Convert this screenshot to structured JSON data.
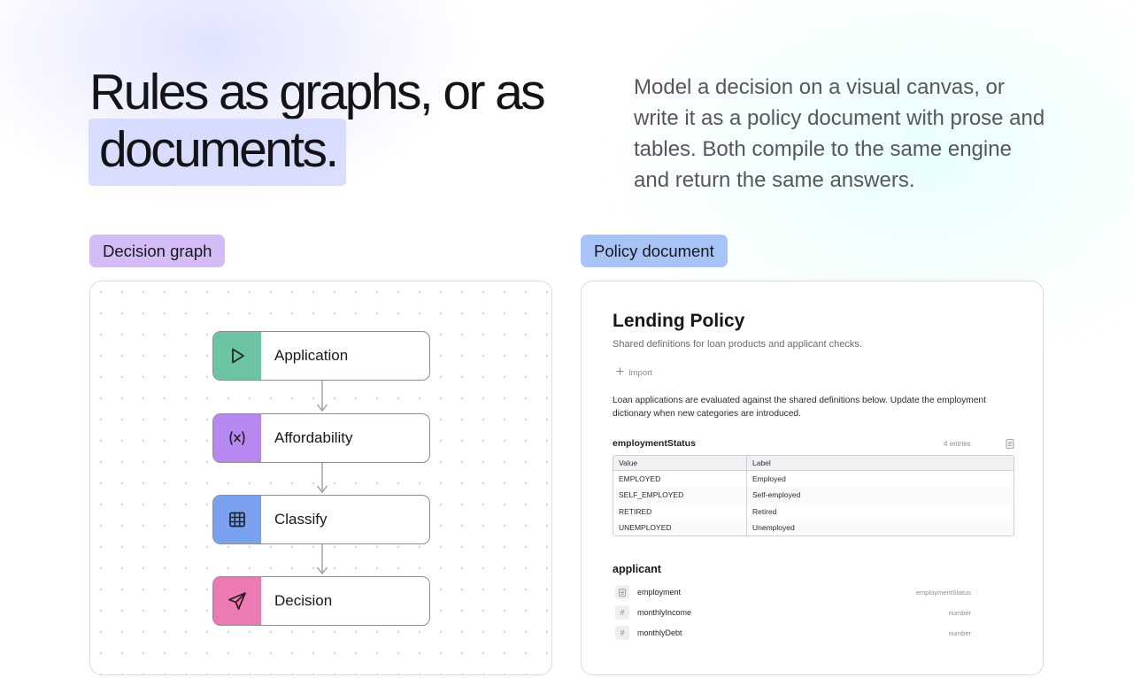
{
  "hero": {
    "title_line1": "Rules as graphs, or as",
    "title_line2": "documents.",
    "subtitle": "Model a decision on a visual canvas, or write it as a policy document with prose and tables. Both compile to the same engine and return the same answers."
  },
  "graph_panel": {
    "label": "Decision graph",
    "nodes": [
      {
        "label": "Application",
        "icon": "play-icon",
        "color": "#6cc4a3"
      },
      {
        "label": "Affordability",
        "icon": "function-icon",
        "color": "#b688f0"
      },
      {
        "label": "Classify",
        "icon": "table-icon",
        "color": "#7aa1ef"
      },
      {
        "label": "Decision",
        "icon": "send-icon",
        "color": "#ec7ab3"
      }
    ]
  },
  "doc_panel": {
    "label": "Policy document",
    "title": "Lending Policy",
    "subtitle": "Shared definitions for loan products and applicant checks.",
    "import_label": "Import",
    "paragraph": "Loan applications are evaluated against the shared definitions below. Update the employment dictionary when new categories are introduced.",
    "dictionary": {
      "name": "employmentStatus",
      "count": "4 entries",
      "headers": [
        "Value",
        "Label"
      ],
      "rows": [
        [
          "EMPLOYED",
          "Employed"
        ],
        [
          "SELF_EMPLOYED",
          "Self-employed"
        ],
        [
          "RETIRED",
          "Retired"
        ],
        [
          "UNEMPLOYED",
          "Unemployed"
        ]
      ]
    },
    "entity": {
      "name": "applicant",
      "fields": [
        {
          "name": "employment",
          "type": "employmentStatus",
          "icon": "list-icon"
        },
        {
          "name": "monthlyIncome",
          "type": "number",
          "icon": "hash-icon"
        },
        {
          "name": "monthlyDebt",
          "type": "number",
          "icon": "hash-icon"
        }
      ]
    }
  }
}
